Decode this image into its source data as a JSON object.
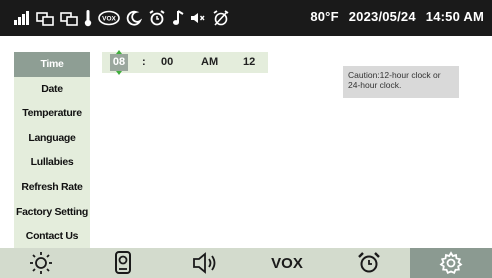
{
  "status_bar": {
    "icons": [
      "signal-icon",
      "monitor-icon",
      "monitor-icon",
      "thermometer-icon",
      "vox-icon",
      "moon-icon",
      "alarm-icon",
      "music-note-icon",
      "volume-icon",
      "no-alarm-icon"
    ],
    "temperature": "80°F",
    "date": "2023/05/24",
    "time": "14:50 AM"
  },
  "sidebar": {
    "items": [
      {
        "label": "Time",
        "active": true
      },
      {
        "label": "Date"
      },
      {
        "label": "Temperature"
      },
      {
        "label": "Language"
      },
      {
        "label": "Lullabies"
      },
      {
        "label": "Refresh Rate"
      },
      {
        "label": "Factory Setting"
      },
      {
        "label": "Contact Us"
      }
    ]
  },
  "time_setting": {
    "hour": "08",
    "colon": ":",
    "minute": "00",
    "period": "AM",
    "format": "12"
  },
  "caution_text": "Caution:12-hour clock or 24-hour clock.",
  "bottom_tabs": [
    {
      "name": "brightness",
      "label": ""
    },
    {
      "name": "camera",
      "label": ""
    },
    {
      "name": "volume",
      "label": ""
    },
    {
      "name": "vox",
      "label": "VOX"
    },
    {
      "name": "alarm",
      "label": ""
    },
    {
      "name": "settings",
      "label": "",
      "active": true
    }
  ],
  "colors": {
    "status_bg": "#1a1a1a",
    "panel_bg": "#e4eddc",
    "active_bg": "#8e9e94",
    "bottom_bg": "#d3dbcd",
    "caution_bg": "#d9d9d9",
    "arrow_green": "#3fae3c"
  }
}
